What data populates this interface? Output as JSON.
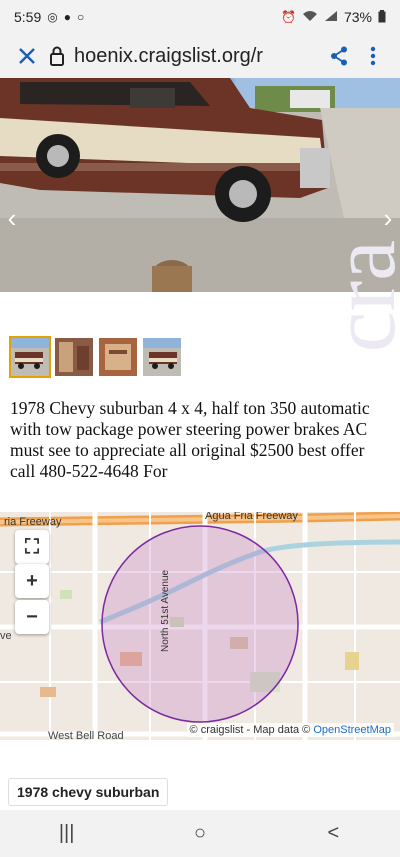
{
  "status_bar": {
    "time": "5:59",
    "battery": "73%"
  },
  "browser": {
    "url": "hoenix.craigslist.org/r"
  },
  "listing": {
    "description": "1978 Chevy suburban 4 x 4, half ton 350 automatic with tow package power steering power brakes AC must see to appreciate all original $2500 best offer call 480-522-4648 For",
    "title": "1978 chevy suburban",
    "watermark": "cra"
  },
  "map": {
    "labels": {
      "freeway_left": "ria Freeway",
      "freeway_top": "Agua Fria Freeway",
      "avenue": "North 51st Avenue",
      "road_bottom": "West Bell Road",
      "left_edge": "ve"
    },
    "attribution": {
      "prefix": "© craigslist - Map data ©",
      "link": "OpenStreetMap"
    },
    "controls": {
      "fullscreen": "⛶",
      "zoom_in": "+",
      "zoom_out": "−"
    }
  },
  "colors": {
    "accent": "#1a5fb4",
    "circle": "#7b2aa1",
    "thumb_selected": "#e5a100"
  },
  "icons": {
    "close": "close-icon",
    "lock": "lock-icon",
    "share": "share-icon",
    "menu": "more-vert-icon",
    "prev": "chevron-left-icon",
    "next": "chevron-right-icon"
  },
  "nav": {
    "recents": "|||",
    "home": "○",
    "back": "<"
  }
}
